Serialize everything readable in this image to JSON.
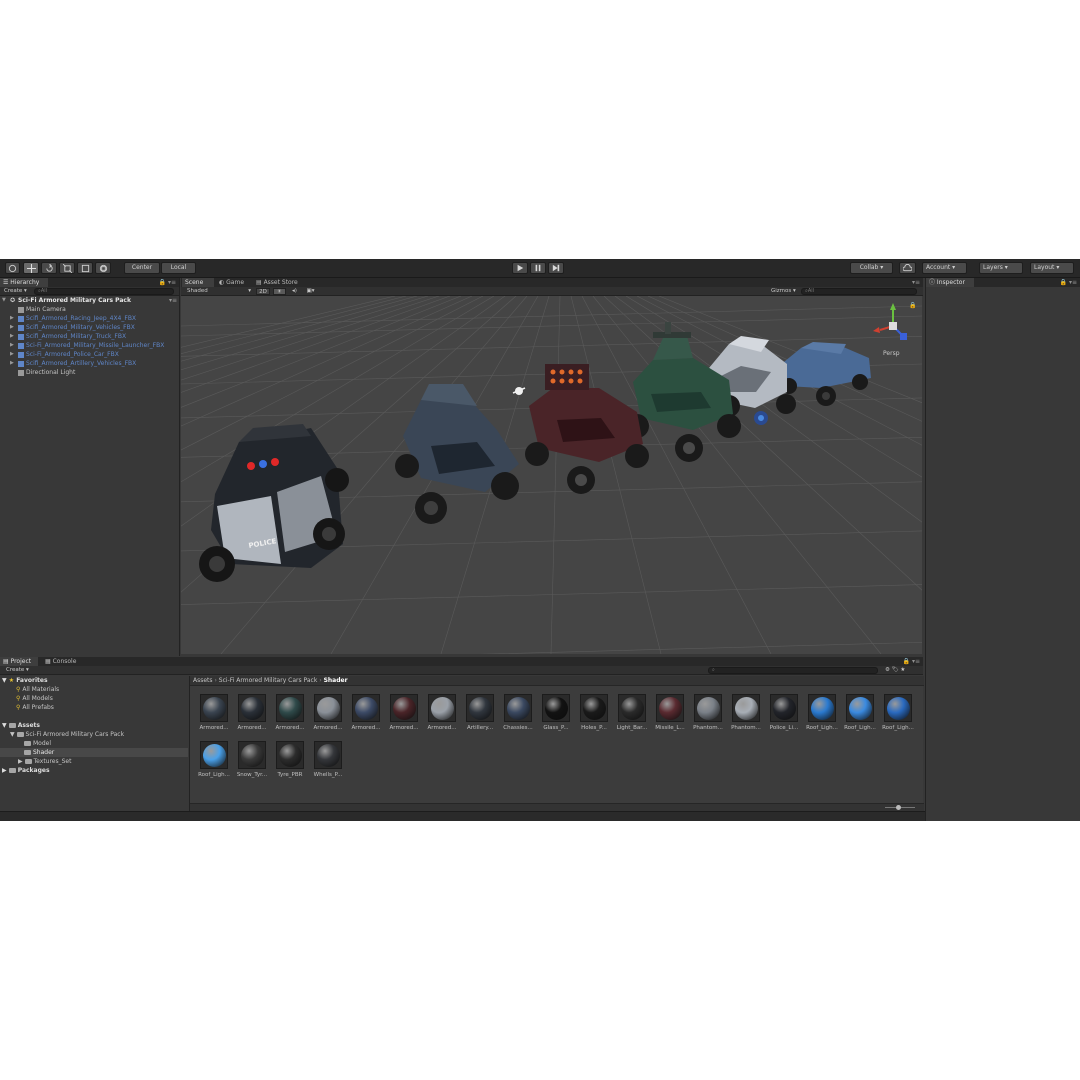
{
  "toolbar": {
    "tools": [
      "hand-tool",
      "move-tool",
      "rotate-tool",
      "scale-tool",
      "rect-tool",
      "transform-tool"
    ],
    "pivot": "Center",
    "space": "Local",
    "collab": "Collab",
    "account": "Account",
    "layers": "Layers",
    "layout": "Layout"
  },
  "hierarchy": {
    "tab": "Hierarchy",
    "create": "Create",
    "search": "All",
    "scene": "Sci-Fi Armored Military Cars Pack",
    "items": [
      {
        "label": "Main Camera",
        "prefab": false,
        "arrow": false
      },
      {
        "label": "Scifi_Armored_Racing_Jeep_4X4_FBX",
        "prefab": true,
        "arrow": true
      },
      {
        "label": "Scifi_Armored_Military_Vehicles_FBX",
        "prefab": true,
        "arrow": true
      },
      {
        "label": "Scifi_Armored_Military_Truck_FBX",
        "prefab": true,
        "arrow": true
      },
      {
        "label": "Sci-Fi_Armored_Military_Missile_Launcher_FBX",
        "prefab": true,
        "arrow": true
      },
      {
        "label": "Sci-Fi_Armored_Police_Car_FBX",
        "prefab": true,
        "arrow": true
      },
      {
        "label": "Scifi_Armored_Artillery_Vehicles_FBX",
        "prefab": true,
        "arrow": true
      },
      {
        "label": "Directional Light",
        "prefab": false,
        "arrow": false
      }
    ]
  },
  "scene": {
    "tabs": [
      "Scene",
      "Game",
      "Asset Store"
    ],
    "shading": "Shaded",
    "mode2d": "2D",
    "gizmos": "Gizmos",
    "search": "All",
    "persp": "Persp",
    "police_text": "POLICE"
  },
  "inspector": {
    "tab": "Inspector"
  },
  "project": {
    "tabs": [
      "Project",
      "Console"
    ],
    "create": "Create",
    "favorites": "Favorites",
    "fav_items": [
      "All Materials",
      "All Models",
      "All Prefabs"
    ],
    "assets": "Assets",
    "pack": "Sci-Fi Armored Military Cars Pack",
    "sub_folders": [
      "Model",
      "Shader",
      "Textures_Set"
    ],
    "packages": "Packages",
    "breadcrumb": [
      "Assets",
      "Sci-Fi Armored Military Cars Pack",
      "Shader"
    ],
    "materials": [
      {
        "label": "Armored...",
        "color": "#3a4450"
      },
      {
        "label": "Armored...",
        "color": "#2a3038"
      },
      {
        "label": "Armored...",
        "color": "#2f4a4a"
      },
      {
        "label": "Armored...",
        "color": "#8a9098"
      },
      {
        "label": "Armored...",
        "color": "#3c4a66"
      },
      {
        "label": "Armored...",
        "color": "#4a2428"
      },
      {
        "label": "Armored...",
        "color": "#9aa0a8"
      },
      {
        "label": "Artillery...",
        "color": "#30363e"
      },
      {
        "label": "Chassies...",
        "color": "#3a4860"
      },
      {
        "label": "Glass_P...",
        "color": "#121212"
      },
      {
        "label": "Holes_P...",
        "color": "#1a1a1a"
      },
      {
        "label": "Light_Bar...",
        "color": "#2a2a2a"
      },
      {
        "label": "Missile_L...",
        "color": "#5a2a30"
      },
      {
        "label": "Phantom...",
        "color": "#7a8088"
      },
      {
        "label": "Phantom...",
        "color": "#a8aeb6"
      },
      {
        "label": "Police_Li...",
        "color": "#22242a"
      },
      {
        "label": "Roof_Ligh...",
        "color": "#2a7ad0"
      },
      {
        "label": "Roof_Ligh...",
        "color": "#3a8ae0"
      },
      {
        "label": "Roof_Ligh...",
        "color": "#2a6ac0"
      },
      {
        "label": "Roof_Ligh...",
        "color": "#4aa0e8"
      },
      {
        "label": "Snow_Tyr...",
        "color": "#3a3a3a"
      },
      {
        "label": "Tyre_PBR",
        "color": "#2c2c2c"
      },
      {
        "label": "Whells_P...",
        "color": "#34363a"
      }
    ]
  },
  "colors": {
    "prefab": "#5f86c8",
    "grid": "#5a5a5a",
    "scene_bg": "#454545"
  }
}
